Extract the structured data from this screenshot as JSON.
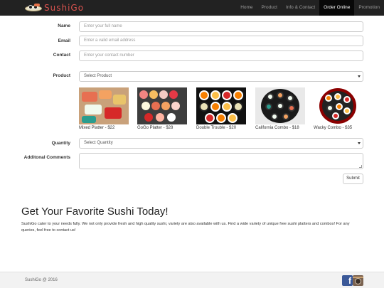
{
  "brand": {
    "name": "SushiGo"
  },
  "nav": {
    "items": [
      {
        "label": "Home"
      },
      {
        "label": "Product"
      },
      {
        "label": "Info & Contact"
      },
      {
        "label": "Order Online"
      },
      {
        "label": "Promotion"
      }
    ],
    "active": "Order Online"
  },
  "form": {
    "name_label": "Name",
    "name_placeholder": "Enter your full name",
    "email_label": "Email",
    "email_placeholder": "Enter a valid email address",
    "contact_label": "Contact",
    "contact_placeholder": "Enter your contact number",
    "product_label": "Product",
    "product_selected": "Select Product",
    "quantity_label": "Quantity",
    "quantity_selected": "Select Quantity",
    "comments_label": "Additonal Comments",
    "submit_label": "Submit"
  },
  "products": [
    {
      "caption": "Mixed Platter - $22"
    },
    {
      "caption": "GoGo Platter - $28"
    },
    {
      "caption": "Double Trouble - $20"
    },
    {
      "caption": "California Combo - $18"
    },
    {
      "caption": "Wacky Combo - $35"
    }
  ],
  "hero": {
    "title": "Get Your Favorite Sushi Today!",
    "text": "SushiGo cater to your needs fully. We not only provide fresh and high quality sushi, variety are also available with us. Find a wide variety of unique free sushi platters and combos! For any queries, feel free to contact us!"
  },
  "footer": {
    "copyright": "SushiGo @ 2016"
  },
  "colors": {
    "navbar": "#222222",
    "brand_red": "#d9534f",
    "facebook": "#3b5998"
  }
}
